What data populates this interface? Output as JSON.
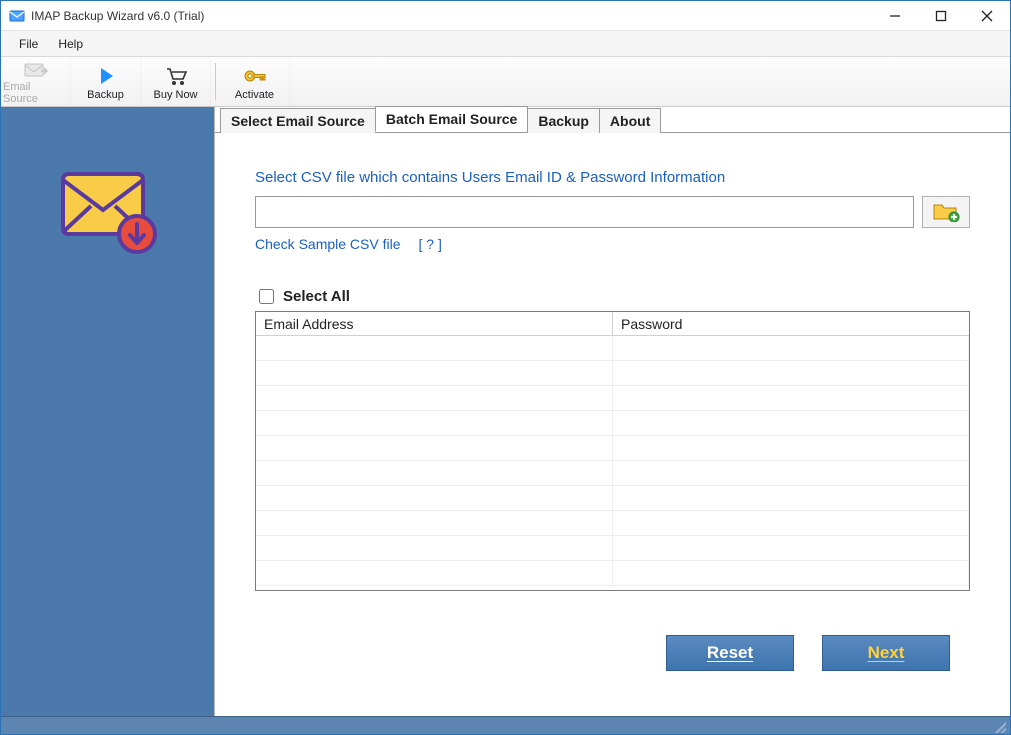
{
  "title": "IMAP Backup Wizard v6.0 (Trial)",
  "menu": {
    "file": "File",
    "help": "Help"
  },
  "toolbar": {
    "email_source": "Email Source",
    "backup": "Backup",
    "buy_now": "Buy Now",
    "activate": "Activate"
  },
  "tabs": {
    "select_email_source": "Select Email Source",
    "batch_email_source": "Batch Email Source",
    "backup": "Backup",
    "about": "About"
  },
  "body": {
    "instruction": "Select CSV file which contains Users Email ID & Password Information",
    "csv_path_value": "",
    "sample_link": "Check Sample CSV file",
    "help_link": "[ ? ]",
    "select_all_label": "Select All",
    "col_email": "Email Address",
    "col_password": "Password",
    "reset_label": "Reset",
    "next_label": "Next"
  }
}
